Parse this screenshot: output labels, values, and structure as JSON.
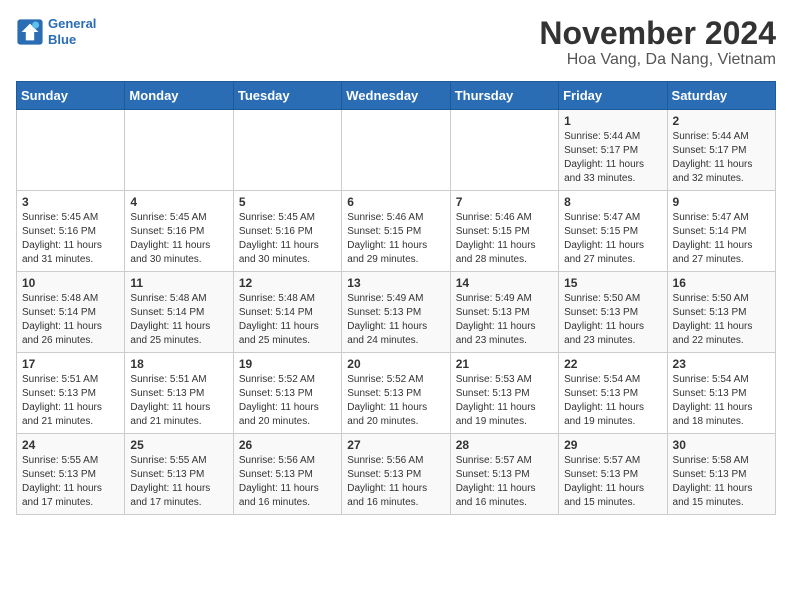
{
  "header": {
    "logo_line1": "General",
    "logo_line2": "Blue",
    "title": "November 2024",
    "subtitle": "Hoa Vang, Da Nang, Vietnam"
  },
  "calendar": {
    "days_of_week": [
      "Sunday",
      "Monday",
      "Tuesday",
      "Wednesday",
      "Thursday",
      "Friday",
      "Saturday"
    ],
    "weeks": [
      [
        {
          "day": "",
          "info": ""
        },
        {
          "day": "",
          "info": ""
        },
        {
          "day": "",
          "info": ""
        },
        {
          "day": "",
          "info": ""
        },
        {
          "day": "",
          "info": ""
        },
        {
          "day": "1",
          "info": "Sunrise: 5:44 AM\nSunset: 5:17 PM\nDaylight: 11 hours\nand 33 minutes."
        },
        {
          "day": "2",
          "info": "Sunrise: 5:44 AM\nSunset: 5:17 PM\nDaylight: 11 hours\nand 32 minutes."
        }
      ],
      [
        {
          "day": "3",
          "info": "Sunrise: 5:45 AM\nSunset: 5:16 PM\nDaylight: 11 hours\nand 31 minutes."
        },
        {
          "day": "4",
          "info": "Sunrise: 5:45 AM\nSunset: 5:16 PM\nDaylight: 11 hours\nand 30 minutes."
        },
        {
          "day": "5",
          "info": "Sunrise: 5:45 AM\nSunset: 5:16 PM\nDaylight: 11 hours\nand 30 minutes."
        },
        {
          "day": "6",
          "info": "Sunrise: 5:46 AM\nSunset: 5:15 PM\nDaylight: 11 hours\nand 29 minutes."
        },
        {
          "day": "7",
          "info": "Sunrise: 5:46 AM\nSunset: 5:15 PM\nDaylight: 11 hours\nand 28 minutes."
        },
        {
          "day": "8",
          "info": "Sunrise: 5:47 AM\nSunset: 5:15 PM\nDaylight: 11 hours\nand 27 minutes."
        },
        {
          "day": "9",
          "info": "Sunrise: 5:47 AM\nSunset: 5:14 PM\nDaylight: 11 hours\nand 27 minutes."
        }
      ],
      [
        {
          "day": "10",
          "info": "Sunrise: 5:48 AM\nSunset: 5:14 PM\nDaylight: 11 hours\nand 26 minutes."
        },
        {
          "day": "11",
          "info": "Sunrise: 5:48 AM\nSunset: 5:14 PM\nDaylight: 11 hours\nand 25 minutes."
        },
        {
          "day": "12",
          "info": "Sunrise: 5:48 AM\nSunset: 5:14 PM\nDaylight: 11 hours\nand 25 minutes."
        },
        {
          "day": "13",
          "info": "Sunrise: 5:49 AM\nSunset: 5:13 PM\nDaylight: 11 hours\nand 24 minutes."
        },
        {
          "day": "14",
          "info": "Sunrise: 5:49 AM\nSunset: 5:13 PM\nDaylight: 11 hours\nand 23 minutes."
        },
        {
          "day": "15",
          "info": "Sunrise: 5:50 AM\nSunset: 5:13 PM\nDaylight: 11 hours\nand 23 minutes."
        },
        {
          "day": "16",
          "info": "Sunrise: 5:50 AM\nSunset: 5:13 PM\nDaylight: 11 hours\nand 22 minutes."
        }
      ],
      [
        {
          "day": "17",
          "info": "Sunrise: 5:51 AM\nSunset: 5:13 PM\nDaylight: 11 hours\nand 21 minutes."
        },
        {
          "day": "18",
          "info": "Sunrise: 5:51 AM\nSunset: 5:13 PM\nDaylight: 11 hours\nand 21 minutes."
        },
        {
          "day": "19",
          "info": "Sunrise: 5:52 AM\nSunset: 5:13 PM\nDaylight: 11 hours\nand 20 minutes."
        },
        {
          "day": "20",
          "info": "Sunrise: 5:52 AM\nSunset: 5:13 PM\nDaylight: 11 hours\nand 20 minutes."
        },
        {
          "day": "21",
          "info": "Sunrise: 5:53 AM\nSunset: 5:13 PM\nDaylight: 11 hours\nand 19 minutes."
        },
        {
          "day": "22",
          "info": "Sunrise: 5:54 AM\nSunset: 5:13 PM\nDaylight: 11 hours\nand 19 minutes."
        },
        {
          "day": "23",
          "info": "Sunrise: 5:54 AM\nSunset: 5:13 PM\nDaylight: 11 hours\nand 18 minutes."
        }
      ],
      [
        {
          "day": "24",
          "info": "Sunrise: 5:55 AM\nSunset: 5:13 PM\nDaylight: 11 hours\nand 17 minutes."
        },
        {
          "day": "25",
          "info": "Sunrise: 5:55 AM\nSunset: 5:13 PM\nDaylight: 11 hours\nand 17 minutes."
        },
        {
          "day": "26",
          "info": "Sunrise: 5:56 AM\nSunset: 5:13 PM\nDaylight: 11 hours\nand 16 minutes."
        },
        {
          "day": "27",
          "info": "Sunrise: 5:56 AM\nSunset: 5:13 PM\nDaylight: 11 hours\nand 16 minutes."
        },
        {
          "day": "28",
          "info": "Sunrise: 5:57 AM\nSunset: 5:13 PM\nDaylight: 11 hours\nand 16 minutes."
        },
        {
          "day": "29",
          "info": "Sunrise: 5:57 AM\nSunset: 5:13 PM\nDaylight: 11 hours\nand 15 minutes."
        },
        {
          "day": "30",
          "info": "Sunrise: 5:58 AM\nSunset: 5:13 PM\nDaylight: 11 hours\nand 15 minutes."
        }
      ]
    ]
  }
}
